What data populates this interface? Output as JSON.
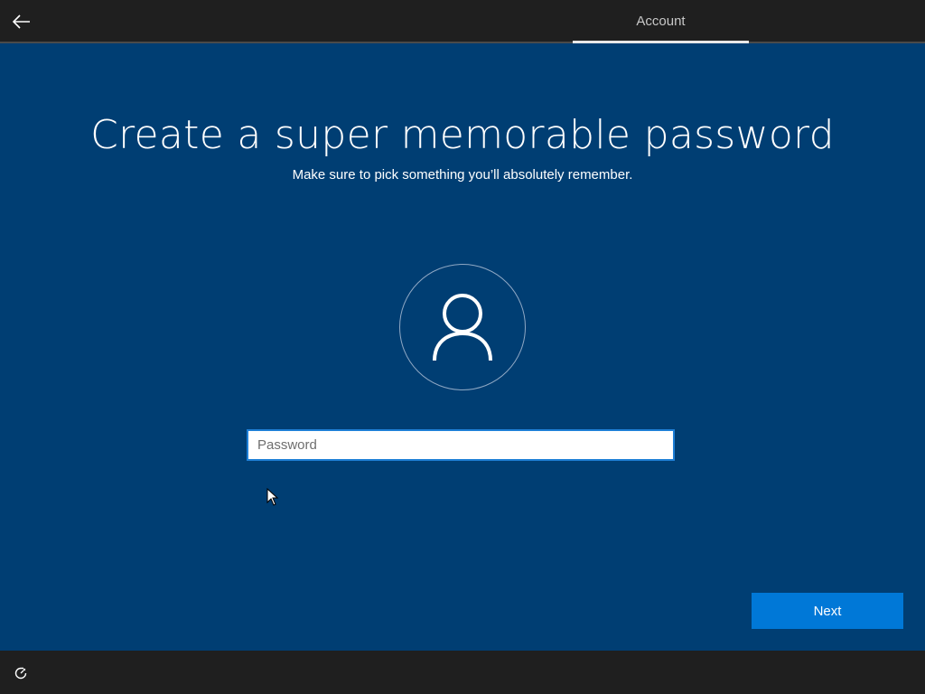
{
  "header": {
    "back_icon": "arrow-left-icon",
    "tab_label": "Account"
  },
  "main": {
    "title": "Create a super memorable password",
    "subtitle": "Make sure to pick something you’ll absolutely remember.",
    "avatar_icon": "user-icon",
    "password_placeholder": "Password",
    "password_value": "",
    "next_label": "Next"
  },
  "footer": {
    "ease_icon": "ease-of-access-icon"
  },
  "colors": {
    "background": "#003e73",
    "bar": "#1f1f1f",
    "accent": "#0078d7"
  }
}
